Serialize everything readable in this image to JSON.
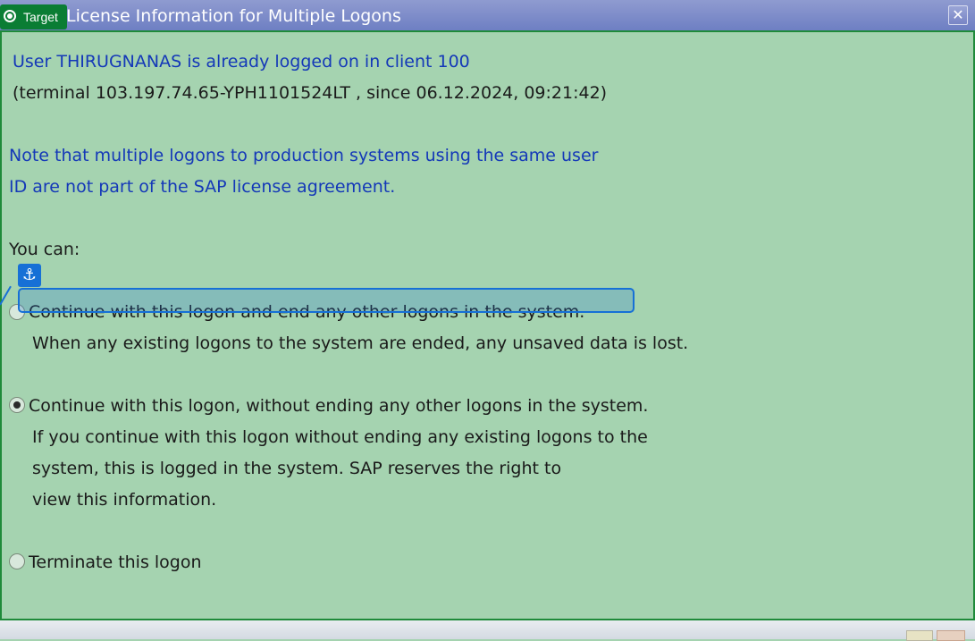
{
  "window": {
    "title": "License Information for Multiple Logons",
    "close_glyph": "✕",
    "target_badge": "Target"
  },
  "info": {
    "user_line": "User THIRUGNANAS is already logged on in client 100",
    "terminal_line": "(terminal 103.197.74.65-YPH1101524LT , since 06.12.2024, 09:21:42)",
    "note_line1": "Note that multiple logons to production systems using the same user",
    "note_line2": "ID are not part of the SAP license agreement.",
    "you_can": "You can:"
  },
  "options": [
    {
      "label": "Continue with this logon and end any other logons in the system.",
      "detail": [
        "When any existing logons to the system are ended, any unsaved data is lost."
      ],
      "selected": false
    },
    {
      "label": "Continue with this logon, without ending any other logons in the system.",
      "detail": [
        "If you continue with this logon without ending any existing logons to the",
        "system, this is logged in the system. SAP reserves the right to",
        "view this information."
      ],
      "selected": true
    },
    {
      "label": "Terminate this logon",
      "detail": [],
      "selected": false
    }
  ],
  "overlay": {
    "anchor_glyph": "⚓"
  },
  "colors": {
    "background": "#a5d3b0",
    "text_blue": "#1438b8",
    "title_bar": "#7e8cc8",
    "target_green": "#0a7d34",
    "highlight_blue": "#1670d6"
  }
}
